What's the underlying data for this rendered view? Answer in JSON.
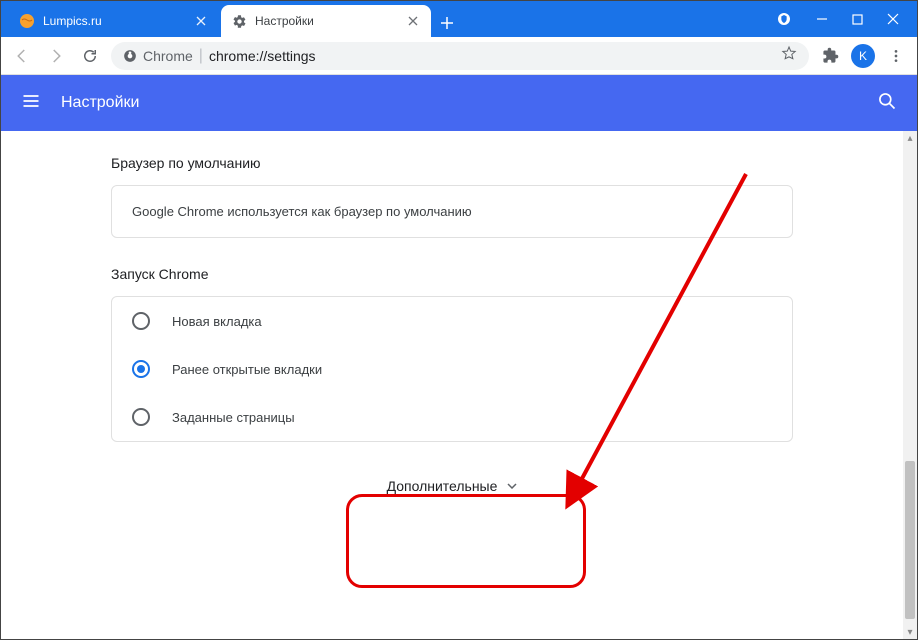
{
  "titlebar": {
    "tabs": [
      {
        "title": "Lumpics.ru",
        "active": false
      },
      {
        "title": "Настройки",
        "active": true
      }
    ],
    "new_tab": "+",
    "user_letter": "K"
  },
  "toolbar": {
    "secure_label": "Chrome",
    "url": "chrome://settings"
  },
  "header": {
    "title": "Настройки"
  },
  "sections": {
    "default_browser": {
      "title": "Браузер по умолчанию",
      "text": "Google Chrome используется как браузер по умолчанию"
    },
    "on_startup": {
      "title": "Запуск Chrome",
      "options": [
        "Новая вкладка",
        "Ранее открытые вкладки",
        "Заданные страницы"
      ],
      "selected_index": 1
    },
    "advanced_label": "Дополнительные"
  }
}
